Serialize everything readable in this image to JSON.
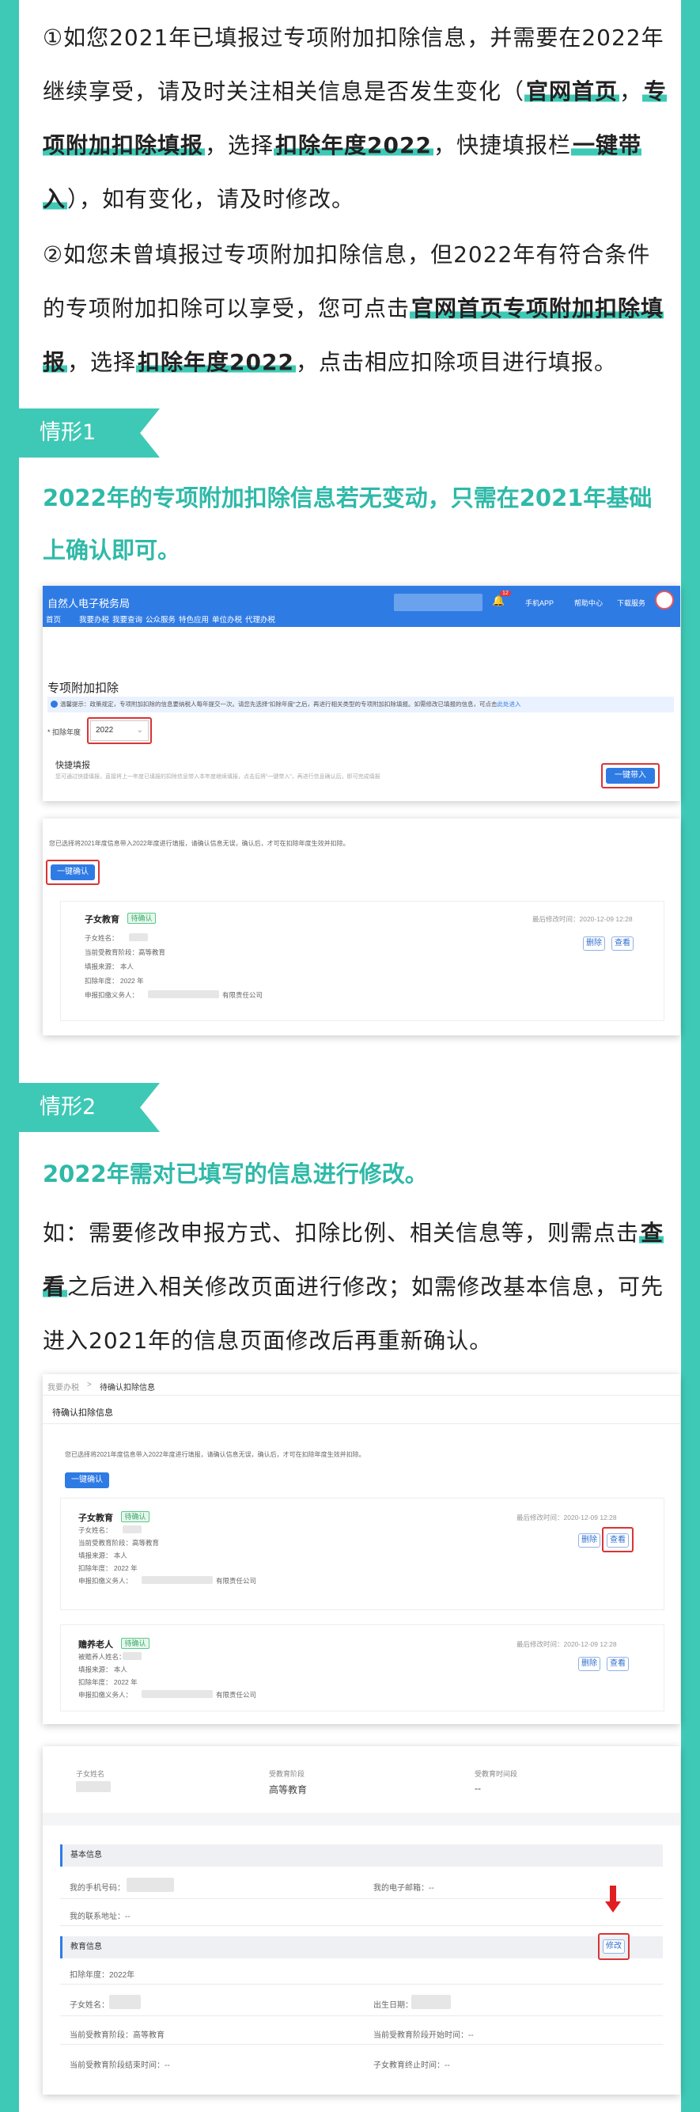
{
  "intro": {
    "p1": [
      {
        "t": "①如您2021年已填报过专项附加扣除信息，并需要在2022年继续享受，请及时关注相关信息是否发生变化（"
      },
      {
        "t": "官网首页",
        "h": true
      },
      {
        "t": "，"
      },
      {
        "t": "专项附加扣除填报",
        "h": true
      },
      {
        "t": "，选择"
      },
      {
        "t": "扣除年度2022",
        "h": true
      },
      {
        "t": "，快捷填报栏"
      },
      {
        "t": "一键带入",
        "h": true
      },
      {
        "t": "），如有变化，请及时修改。"
      }
    ],
    "p2": [
      {
        "t": "②如您未曾填报过专项附加扣除信息，但2022年有符合条件的专项附加扣除可以享受，您可点击"
      },
      {
        "t": "官网首页专项附加扣除填报",
        "h": true
      },
      {
        "t": "，选择"
      },
      {
        "t": "扣除年度2022",
        "h": true
      },
      {
        "t": "，点击相应扣除项目进行填报。"
      }
    ]
  },
  "case1": {
    "tag": "情形1",
    "heading": "2022年的专项附加扣除信息若无变动，只需在2021年基础上确认即可。",
    "portal": {
      "logo": "自然人电子税务局",
      "top_links": [
        "手机APP",
        "帮助中心",
        "下载服务"
      ],
      "badge": "12",
      "nav": [
        "首页",
        "我要办税",
        "我要查询",
        "公众服务",
        "特色应用",
        "单位办税",
        "代理办税"
      ],
      "title": "专项附加扣除",
      "notice": "温馨提示：政策规定，专项附加扣除的信息要纳税人每年提交一次。请您先选择“扣除年度”之后，再进行相关类型的专项附加扣除填报。如需修改已填报的信息，可点击",
      "notice_link": "此处进入",
      "year_label": "* 扣除年度",
      "year_value": "2022",
      "quick_title": "快捷填报",
      "quick_desc": "您可通过快捷填报，直接将上一年度已填报的扣除信息带入本年度继续填报，点击后将“一键带入”，再进行信息确认后，即可完成填报",
      "import_btn": "一键带入"
    },
    "confirm": {
      "desc": "您已选择将2021年度信息带入2022年度进行填报，请确认信息无误，确认后，才可在扣除年度生效并扣除。",
      "confirm_btn": "一键确认",
      "item_title": "子女教育",
      "item_tag": "待确认",
      "modified": "最后修改时间：2020-12-09 12:28",
      "fields": [
        "子女姓名：",
        "当前受教育阶段：高等教育",
        "填报来源：  本人",
        "扣除年度：  2022 年",
        "申报扣缴义务人："
      ],
      "company_suffix": "有限责任公司",
      "delete_btn": "删除",
      "view_btn": "查看"
    }
  },
  "case2": {
    "tag": "情形2",
    "heading": "2022年需对已填写的信息进行修改。",
    "body": [
      {
        "t": "如：需要修改申报方式、扣除比例、相关信息等，则需点击"
      },
      {
        "t": "查看",
        "h": true
      },
      {
        "t": "之后进入相关修改页面进行修改；如需修改基本信息，可先进入2021年的信息页面修改后再重新确认。"
      }
    ],
    "pending": {
      "breadcrumb_home": "我要办税",
      "breadcrumb_sep": ">",
      "breadcrumb_cur": "待确认扣除信息",
      "title": "待确认扣除信息",
      "desc": "您已选择将2021年度信息带入2022年度进行填报，请确认信息无误，确认后，才可在扣除年度生效并扣除。",
      "confirm_btn": "一键确认",
      "items": [
        {
          "title": "子女教育",
          "tag": "待确认",
          "modified": "最后修改时间：2020-12-09 12:28",
          "fields": [
            "子女姓名：",
            "当前受教育阶段：高等教育",
            "填报来源：  本人",
            "扣除年度：  2022 年",
            "申报扣缴义务人："
          ],
          "delete": "删除",
          "view": "查看"
        },
        {
          "title": "赡养老人",
          "tag": "待确认",
          "modified": "最后修改时间：2020-12-09 12:28",
          "fields": [
            "被赡养人姓名：",
            "填报来源：  本人",
            "扣除年度：  2022 年",
            "申报扣缴义务人："
          ],
          "delete": "删除",
          "view": "查看"
        }
      ],
      "company_suffix": "有限责任公司"
    },
    "detail": {
      "head_labels": [
        "子女姓名",
        "受教育阶段",
        "受教育时间段"
      ],
      "head_values": [
        "",
        "高等教育",
        "--"
      ],
      "basic_title": "基本信息",
      "phone_label": "我的手机号码：",
      "email_label": "我的电子邮箱：--",
      "address_label": "我的联系地址：--",
      "edu_title": "教育信息",
      "modify_btn": "修改",
      "deduct_year": "扣除年度：2022年",
      "child_name": "子女姓名：",
      "birth": "出生日期：",
      "stage": "当前受教育阶段：高等教育",
      "stage_start": "当前受教育阶段开始时间：--",
      "stage_end": "当前受教育阶段结束时间：--",
      "edu_end": "子女教育终止时间：--"
    }
  },
  "colors": {
    "accent": "#3ec9b6",
    "teal_text": "#2fb9a8",
    "link_blue": "#2f7be4",
    "alert_red": "#d33"
  }
}
